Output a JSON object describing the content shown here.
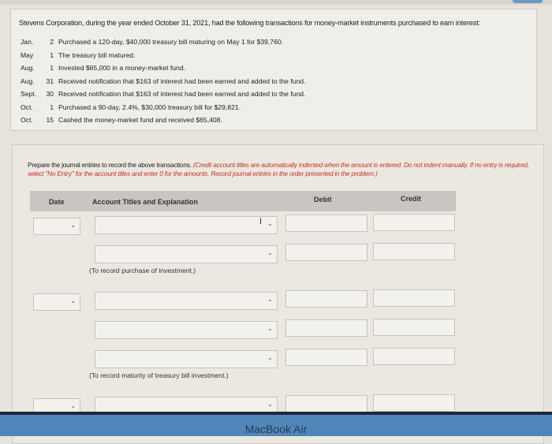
{
  "problem": {
    "intro": "Stevens Corporation, during the year ended October 31, 2021, had the following transactions for money-market instruments purchased to earn interest:",
    "transactions": [
      {
        "month": "Jan.",
        "day": "2",
        "text": "Purchased a 120-day, $40,000 treasury bill maturing on May 1 for $39,760."
      },
      {
        "month": "May",
        "day": "1",
        "text": "The treasury bill matured."
      },
      {
        "month": "Aug.",
        "day": "1",
        "text": "Invested $65,000 in a money-market fund."
      },
      {
        "month": "Aug.",
        "day": "31",
        "text": "Received notification that $163 of interest had been earned and added to the fund."
      },
      {
        "month": "Sept.",
        "day": "30",
        "text": "Received notification that $163 of interest had been earned and added to the fund."
      },
      {
        "month": "Oct.",
        "day": "1",
        "text": "Purchased a 90-day, 2.4%, $30,000 treasury bill for $29,821."
      },
      {
        "month": "Oct.",
        "day": "15",
        "text": "Cashed the money-market fund and received $65,408."
      }
    ]
  },
  "task": {
    "instruction": "Prepare the journal entries to record the above transactions.",
    "note": "(Credit account titles are automatically indented when the amount is entered. Do not indent manually. If no entry is required, select \"No Entry\" for the account titles and enter 0 for the amounts. Record journal entries in the order presented in the problem.)",
    "headers": {
      "date": "Date",
      "account": "Account Titles and Explanation",
      "debit": "Debit",
      "credit": "Credit"
    },
    "entries": [
      {
        "date": "",
        "lines": [
          {
            "account": "",
            "debit": "",
            "credit": ""
          },
          {
            "account": "",
            "debit": "",
            "credit": ""
          }
        ],
        "explanation": "(To record purchase of investment.)"
      },
      {
        "date": "",
        "lines": [
          {
            "account": "",
            "debit": "",
            "credit": ""
          },
          {
            "account": "",
            "debit": "",
            "credit": ""
          },
          {
            "account": "",
            "debit": "",
            "credit": ""
          }
        ],
        "explanation": "(To record maturity of treasury bill investment.)"
      },
      {
        "date": "",
        "lines": [
          {
            "account": "",
            "debit": "",
            "credit": ""
          }
        ]
      }
    ]
  },
  "device": {
    "brand": "MacBook Air"
  },
  "icons": {
    "chevron": "chevron-down-icon",
    "cursor": "text-cursor-icon"
  }
}
